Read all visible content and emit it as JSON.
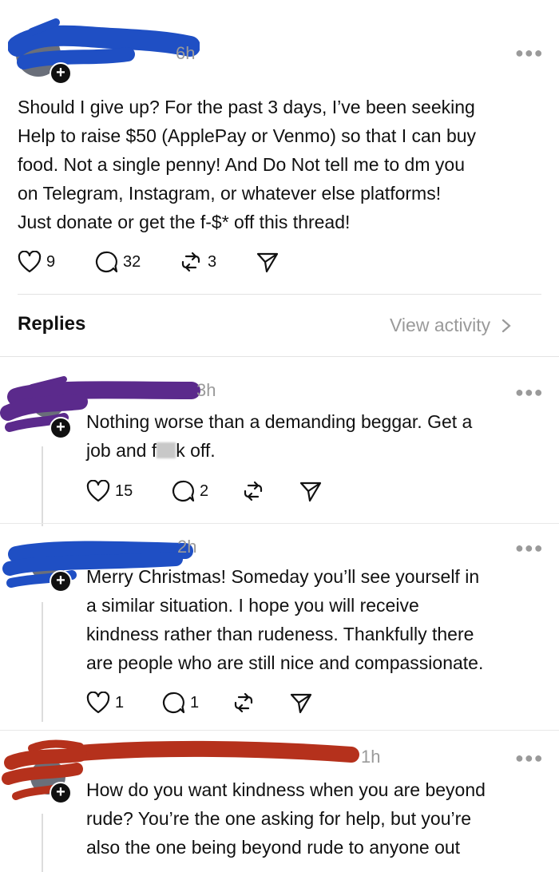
{
  "original_post": {
    "time": "6h",
    "text_lines": [
      "Should I give up?  For the past 3 days, I’ve been seeking",
      "Help to raise $50 (ApplePay or Venmo) so that I can buy",
      "food.  Not a single penny!  And Do Not tell me to dm you",
      "on Telegram, Instagram, or whatever else platforms!",
      "Just donate or get the f-$* off this thread!"
    ],
    "likes": "9",
    "comments": "32",
    "reposts": "3"
  },
  "replies_header": {
    "title": "Replies",
    "view_activity": "View activity"
  },
  "replies": [
    {
      "time": "3h",
      "text_lines": [
        "Nothing worse than a demanding beggar. Get a",
        "job and f",
        "k off."
      ],
      "likes": "15",
      "comments": "2",
      "redaction_color": "#5b2a8c"
    },
    {
      "time": "2h",
      "text_lines": [
        "Merry Christmas!  Someday you’ll see yourself in",
        "a similar situation.  I hope you will receive",
        "kindness rather than rudeness.  Thankfully there",
        "are people who are still nice and compassionate."
      ],
      "likes": "1",
      "comments": "1",
      "redaction_color": "#1f4fc4"
    },
    {
      "time": "1h",
      "text_lines": [
        "How do you want kindness when you are beyond",
        "rude?  You’re the one asking for help, but you’re",
        "also the one being beyond rude to anyone out"
      ],
      "redaction_color": "#b5311c"
    }
  ],
  "icons": {
    "like": "heart-icon",
    "comment": "comment-bubble-icon",
    "repost": "repost-icon",
    "share": "send-icon",
    "more": "more-options-icon",
    "follow": "plus-icon"
  },
  "colors": {
    "op_redaction": "#1f4fc4",
    "muted_text": "#9a9a9a"
  }
}
